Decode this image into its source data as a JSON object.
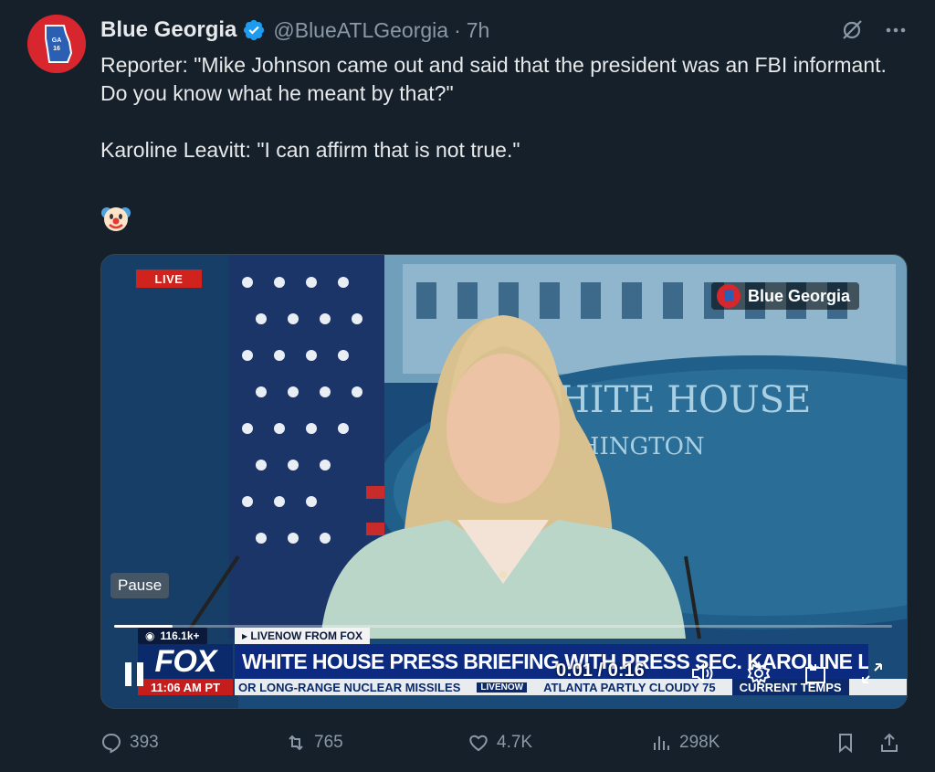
{
  "author": {
    "name": "Blue Georgia",
    "handle": "@BlueATLGeorgia",
    "separator": "·",
    "time": "7h",
    "avatar_text": "GA 16"
  },
  "tweet": {
    "text_line1": "Reporter: \"Mike Johnson came out and said that the president was an FBI informant. Do you know what he meant by that?\"",
    "text_line2": "Karoline Leavitt: \"I can affirm that is not true.\"",
    "emoji": "🤡"
  },
  "video": {
    "live_badge": "LIVE",
    "watermark": "Blue Georgia",
    "pause_tooltip": "Pause",
    "time_readout": "0:01 / 0:16",
    "progress_fraction": 0.075,
    "backdrop_text_1": "HITE HOUSE",
    "backdrop_text_2": "SHINGTON",
    "chyron": {
      "viewers": "116.1k+",
      "livenow": "▸ LIVENOW FROM FOX",
      "network": "FOX",
      "clock": "11:06 AM PT",
      "headline": "WHITE HOUSE PRESS BRIEFING WITH PRESS SEC. KAROLINE LEAVITT",
      "ticker_text": "OR LONG-RANGE NUCLEAR MISSILES",
      "ticker_live": "LIVENOW",
      "ticker_weather": "ATLANTA  PARTLY CLOUDY 75",
      "ticker_end": "CURRENT TEMPS"
    }
  },
  "actions": {
    "replies": "393",
    "reposts": "765",
    "likes": "4.7K",
    "views": "298K"
  },
  "colors": {
    "background": "#15202b",
    "text": "#e7e9ea",
    "muted": "#8b98a5",
    "verified": "#1d9bf0",
    "fox_red": "#c61c1c",
    "fox_blue": "#0b2a80"
  }
}
